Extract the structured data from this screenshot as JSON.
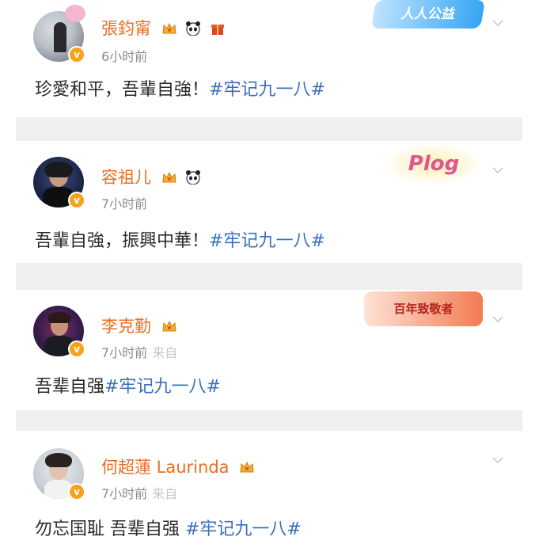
{
  "posts": [
    {
      "name": "張鈞甯",
      "time": "6小时前",
      "source": "",
      "text": "珍愛和平，吾輩自強！",
      "tag": "#牢记九一八#",
      "decoration": "人人公益"
    },
    {
      "name": "容祖儿",
      "time": "7小时前",
      "source": "",
      "text": "吾輩自強，振興中華！",
      "tag": "#牢记九一八#",
      "decoration": "Plog"
    },
    {
      "name": "李克勤",
      "time": "7小时前",
      "source": "来自",
      "text": "吾辈自强",
      "tag": "#牢记九一八#",
      "decoration": "百年致敬者"
    },
    {
      "name": "何超蓮 Laurinda",
      "time": "7小时前",
      "source": "来自",
      "text": "勿忘国耻 吾辈自强 ",
      "tag": "#牢记九一八#",
      "decoration": ""
    }
  ],
  "colors": {
    "username": "#ea6f22",
    "hashtag": "#3b6fbd",
    "meta": "#8b8b8b",
    "verified_badge": "#f7a21a"
  },
  "icons": [
    "verified-v-icon",
    "crown-icon",
    "panda-icon",
    "chevron-down-icon"
  ]
}
